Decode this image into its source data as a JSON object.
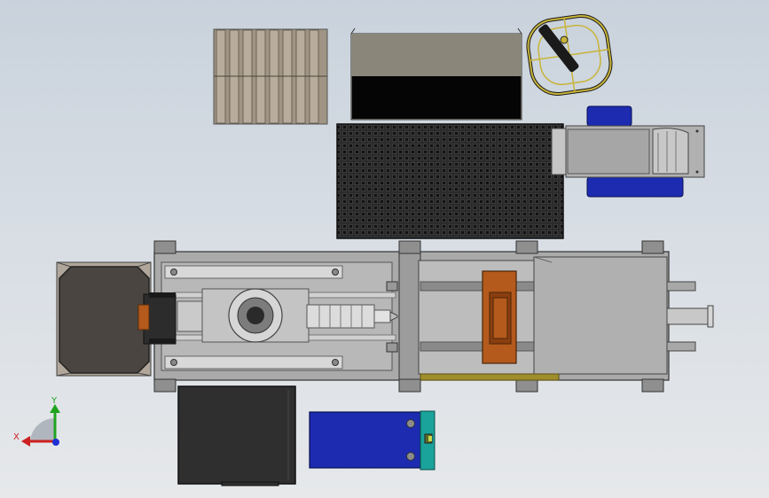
{
  "viewport": {
    "background_top": "#c9d2dc",
    "background_bottom": "#e6e8ea"
  },
  "triad": {
    "x_label": "X",
    "y_label": "Y",
    "x_color": "#cc1f1f",
    "y_color": "#1fa31f",
    "z_color": "#1f2fd4"
  },
  "colors": {
    "steel": "#9a9a9a",
    "steel_light": "#c4c4c4",
    "dark_panel": "#3e3a36",
    "blue_unit": "#1c2bb0",
    "teal_unit": "#1aa39a",
    "bronze": "#b35a1c",
    "pallet_wood": "#9c9080",
    "mesh_dark": "#222222",
    "fan_yellow": "#c8b43a"
  },
  "components": [
    "pallet",
    "cover-box",
    "cooling-fan",
    "mesh-grid",
    "hydraulic-motor",
    "electrical-cabinet",
    "injection-unit",
    "clamping-unit",
    "mould",
    "control-box",
    "pump-unit"
  ]
}
